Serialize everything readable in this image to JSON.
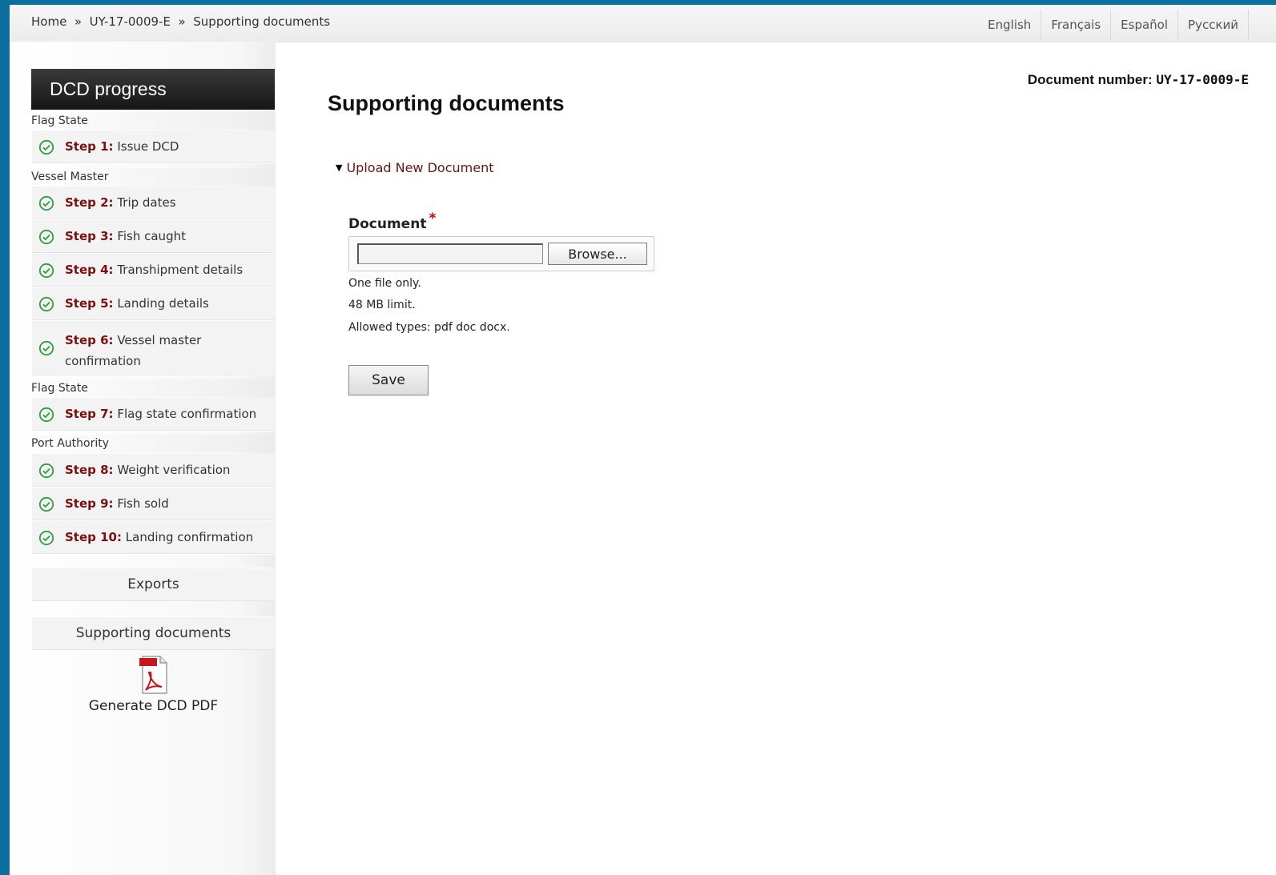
{
  "breadcrumb": [
    "Home",
    "»",
    "UY-17-0009-E",
    "»",
    "Supporting documents"
  ],
  "languages": [
    "English",
    "Français",
    "Español",
    "Русский"
  ],
  "sidebar": {
    "title": "DCD progress",
    "roles": [
      "Flag State",
      "Vessel Master",
      "Flag State",
      "Port Authority"
    ],
    "steps": [
      {
        "num": "Step 1:",
        "label": "Issue DCD",
        "status": "check-circle-icon"
      },
      {
        "num": "Step 2:",
        "label": "Trip dates",
        "status": "check-circle-icon"
      },
      {
        "num": "Step 3:",
        "label": "Fish caught",
        "status": "check-circle-icon"
      },
      {
        "num": "Step 4:",
        "label": "Transhipment details",
        "status": "check-circle-icon"
      },
      {
        "num": "Step 5:",
        "label": "Landing details",
        "status": "check-circle-icon"
      },
      {
        "num": "Step 6:",
        "label": "Vessel master confirmation",
        "status": "check-circle-icon"
      },
      {
        "num": "Step 7:",
        "label": "Flag state confirmation",
        "status": "check-circle-icon"
      },
      {
        "num": "Step 8:",
        "label": "Weight verification",
        "status": "check-circle-icon"
      },
      {
        "num": "Step 9:",
        "label": "Fish sold",
        "status": "check-circle-icon"
      },
      {
        "num": "Step 10:",
        "label": "Landing confirmation",
        "status": "check-circle-icon"
      }
    ],
    "exports": "Exports",
    "supporting": "Supporting documents",
    "pdf_label": "Generate DCD PDF"
  },
  "main": {
    "doc_number_label": "Document number:",
    "doc_number_value": "UY-17-0009-E",
    "title": "Supporting documents",
    "upload_toggle": "Upload New Document",
    "field_label": "Document",
    "required_mark": "*",
    "file_value": "",
    "browse_label": "Browse...",
    "hints": [
      "One file only.",
      "48 MB limit.",
      "Allowed types: pdf doc docx."
    ],
    "save_label": "Save"
  },
  "colors": {
    "background_frame": "#0b6e9e",
    "step_number": "#7a1010",
    "check_icon": "#2e9e3e",
    "required": "#cc0000"
  }
}
